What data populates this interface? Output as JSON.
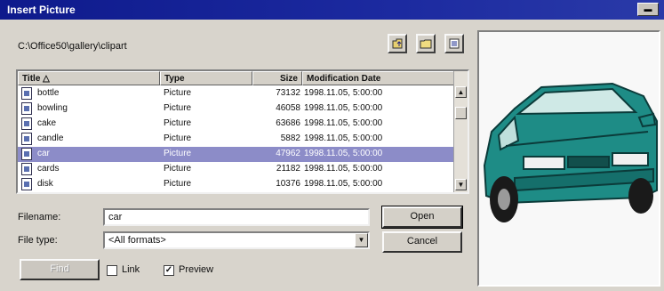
{
  "window": {
    "title": "Insert Picture",
    "title_button": "▬"
  },
  "toolbar": {
    "path": "C:\\Office50\\gallery\\clipart"
  },
  "list": {
    "columns": {
      "title": "Title",
      "type": "Type",
      "size": "Size",
      "date": "Modification Date"
    },
    "rows": [
      {
        "title": "bottle",
        "type": "Picture",
        "size": "73132",
        "date": "1998.11.05, 5:00:00"
      },
      {
        "title": "bowling",
        "type": "Picture",
        "size": "46058",
        "date": "1998.11.05, 5:00:00"
      },
      {
        "title": "cake",
        "type": "Picture",
        "size": "63686",
        "date": "1998.11.05, 5:00:00"
      },
      {
        "title": "candle",
        "type": "Picture",
        "size": "5882",
        "date": "1998.11.05, 5:00:00"
      },
      {
        "title": "car",
        "type": "Picture",
        "size": "47962",
        "date": "1998.11.05, 5:00:00"
      },
      {
        "title": "cards",
        "type": "Picture",
        "size": "21182",
        "date": "1998.11.05, 5:00:00"
      },
      {
        "title": "disk",
        "type": "Picture",
        "size": "10376",
        "date": "1998.11.05, 5:00:00"
      }
    ]
  },
  "form": {
    "filename_label": "Filename:",
    "filename_value": "car",
    "filetype_label": "File type:",
    "filetype_value": "<All formats>",
    "open_button": "Open",
    "cancel_button": "Cancel",
    "find_button": "Find",
    "link_label": "Link",
    "preview_label": "Preview",
    "link_checked": false,
    "preview_checked": true
  },
  "colors": {
    "title_bar": "#0e1a8c",
    "selection": "#8c8cc8",
    "car_body": "#1e8c86"
  }
}
